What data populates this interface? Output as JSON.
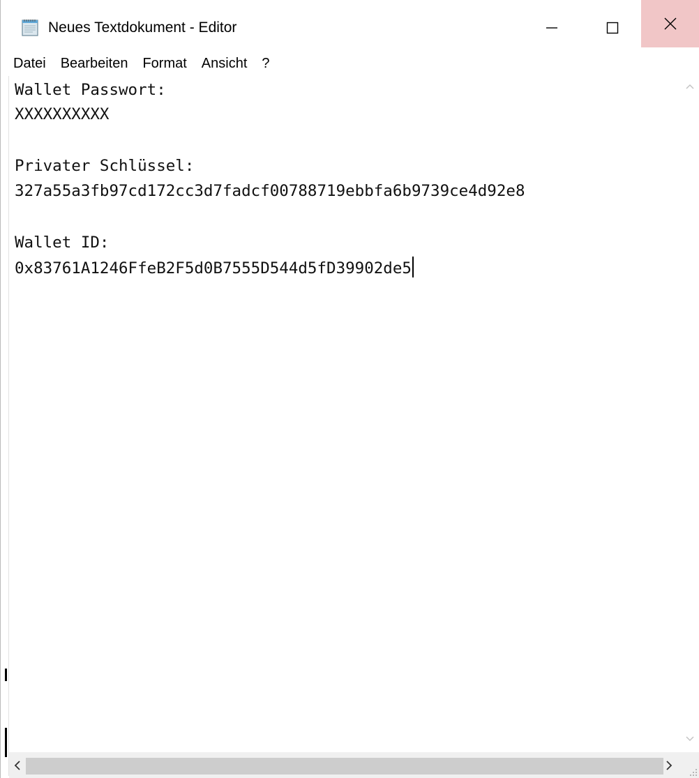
{
  "window": {
    "title": "Neues Textdokument - Editor"
  },
  "title_buttons": {
    "minimize": "minimize-icon",
    "maximize": "maximize-icon",
    "close": "close-icon",
    "close_hover_color": "#f1c6c7"
  },
  "menu": {
    "items": [
      "Datei",
      "Bearbeiten",
      "Format",
      "Ansicht",
      "?"
    ]
  },
  "document": {
    "lines": [
      "Wallet Passwort:",
      "XXXXXXXXXX",
      "Privater Schlüssel:",
      "327a55a3fb97cd172cc3d7fadcf00788719ebbfa6b9739ce4d92e8",
      "Wallet ID:",
      "0x83761A1246FfeB2F5d0B7555D544d5fD39902de5"
    ]
  },
  "icons": {
    "app": "notepad-icon",
    "scroll_up": "chevron-up-icon",
    "scroll_down": "chevron-down-icon",
    "scroll_left": "chevron-left-icon",
    "scroll_right": "chevron-right-icon",
    "resize": "resize-grip-icon"
  }
}
